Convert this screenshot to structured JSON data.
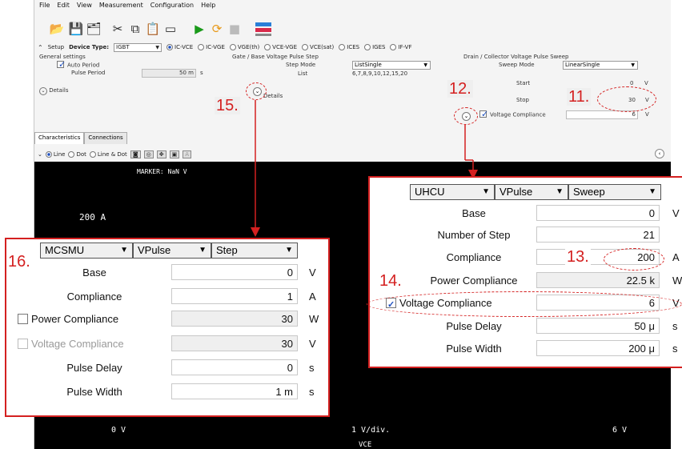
{
  "menu": [
    "File",
    "Edit",
    "View",
    "Measurement",
    "Configuration",
    "Help"
  ],
  "setup": {
    "setup_label": "Setup",
    "device_type_label": "Device Type:",
    "device_type_value": "IGBT",
    "modes": [
      "IC-VCE",
      "IC-VGE",
      "VGE(th)",
      "VCE-VGE",
      "VCE(sat)",
      "ICES",
      "IGES",
      "IF-VF"
    ],
    "selected_mode": "IC-VCE"
  },
  "general": {
    "title": "General settings",
    "auto_period": "Auto Period",
    "pulse_period_label": "Pulse Period",
    "pulse_period_value": "50 m",
    "pulse_period_unit": "s",
    "details": "Details"
  },
  "gate": {
    "title": "Gate / Base Voltage Pulse Step",
    "step_mode_label": "Step Mode",
    "step_mode_value": "ListSingle",
    "list_label": "List",
    "list_value": "6,7,8,9,10,12,15,20",
    "details": "Details"
  },
  "drain": {
    "title": "Drain / Collector Voltage Pulse Sweep",
    "sweep_mode_label": "Sweep Mode",
    "sweep_mode_value": "LinearSingle",
    "start_label": "Start",
    "start_value": "0",
    "stop_label": "Stop",
    "stop_value": "30",
    "unit_v": "V",
    "vcomp_label": "Voltage Compliance",
    "vcomp_value": "6"
  },
  "tabs": [
    "Characteristics",
    "Connections"
  ],
  "chart_controls": {
    "line": "Line",
    "dot": "Dot",
    "line_dot": "Line & Dot"
  },
  "chart": {
    "marker": "MARKER: NaN V",
    "y_top": "200 A",
    "x_left": "0 V",
    "x_mid": "1 V/div.",
    "x_right": "6 V",
    "x_name": "VCE"
  },
  "callouts": {
    "c11": "11.",
    "c12": "12.",
    "c13": "13.",
    "c14": "14.",
    "c15": "15.",
    "c16": "16."
  },
  "collector_panel": {
    "dd1": "UHCU",
    "dd2": "VPulse",
    "dd3": "Sweep",
    "rows": [
      {
        "label": "Base",
        "value": "0",
        "unit": "V"
      },
      {
        "label": "Number of Step",
        "value": "21",
        "unit": ""
      },
      {
        "label": "Compliance",
        "value": "200",
        "unit": "A"
      },
      {
        "label": "Power Compliance",
        "value": "22.5 k",
        "unit": "W"
      },
      {
        "label": "Voltage Compliance",
        "value": "6",
        "unit": "V"
      },
      {
        "label": "Pulse Delay",
        "value": "50 μ",
        "unit": "s"
      },
      {
        "label": "Pulse Width",
        "value": "200 μ",
        "unit": "s"
      }
    ]
  },
  "gate_panel": {
    "dd1": "MCSMU",
    "dd2": "VPulse",
    "dd3": "Step",
    "rows": [
      {
        "label": "Base",
        "value": "0",
        "unit": "V"
      },
      {
        "label": "Compliance",
        "value": "1",
        "unit": "A"
      },
      {
        "label": "Power Compliance",
        "value": "30",
        "unit": "W"
      },
      {
        "label": "Voltage Compliance",
        "value": "30",
        "unit": "V"
      },
      {
        "label": "Pulse Delay",
        "value": "0",
        "unit": "s"
      },
      {
        "label": "Pulse Width",
        "value": "1 m",
        "unit": "s"
      }
    ]
  }
}
